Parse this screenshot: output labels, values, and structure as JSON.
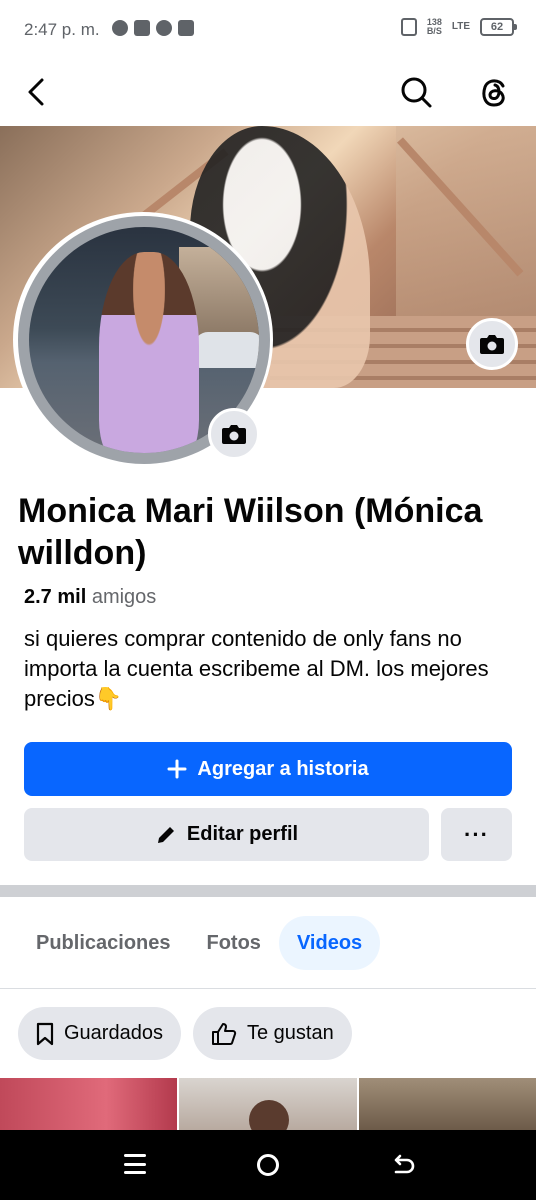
{
  "status_bar": {
    "time": "2:47 p. m.",
    "net_speed_value": "138",
    "net_speed_unit": "B/S",
    "network": "LTE",
    "battery": "62",
    "left_icons": [
      "messenger-icon",
      "telegram-icon",
      "threads-icon",
      "gmail-icon"
    ]
  },
  "top_nav": {
    "back_icon": "chevron-left-icon",
    "search_icon": "search-icon",
    "threads_icon": "threads-icon"
  },
  "profile": {
    "name": "Monica Mari Wiilson (Mónica willdon)",
    "friends_count": "2.7 mil",
    "friends_label": "amigos",
    "bio": "si quieres comprar contenido de only fans no importa la cuenta escribeme al DM. los mejores precios👇"
  },
  "actions": {
    "add_story_label": "Agregar a historia",
    "edit_profile_label": "Editar perfil",
    "more_label": "···"
  },
  "tabs": [
    {
      "label": "Publicaciones",
      "active": false
    },
    {
      "label": "Fotos",
      "active": false
    },
    {
      "label": "Videos",
      "active": true
    }
  ],
  "chips": [
    {
      "label": "Guardados",
      "icon": "bookmark-icon"
    },
    {
      "label": "Te gustan",
      "icon": "thumbs-up-icon"
    }
  ],
  "colors": {
    "primary": "#0866ff",
    "button_gray": "#e4e6eb",
    "active_tab_bg": "#ebf5ff",
    "secondary_text": "#65676b"
  }
}
